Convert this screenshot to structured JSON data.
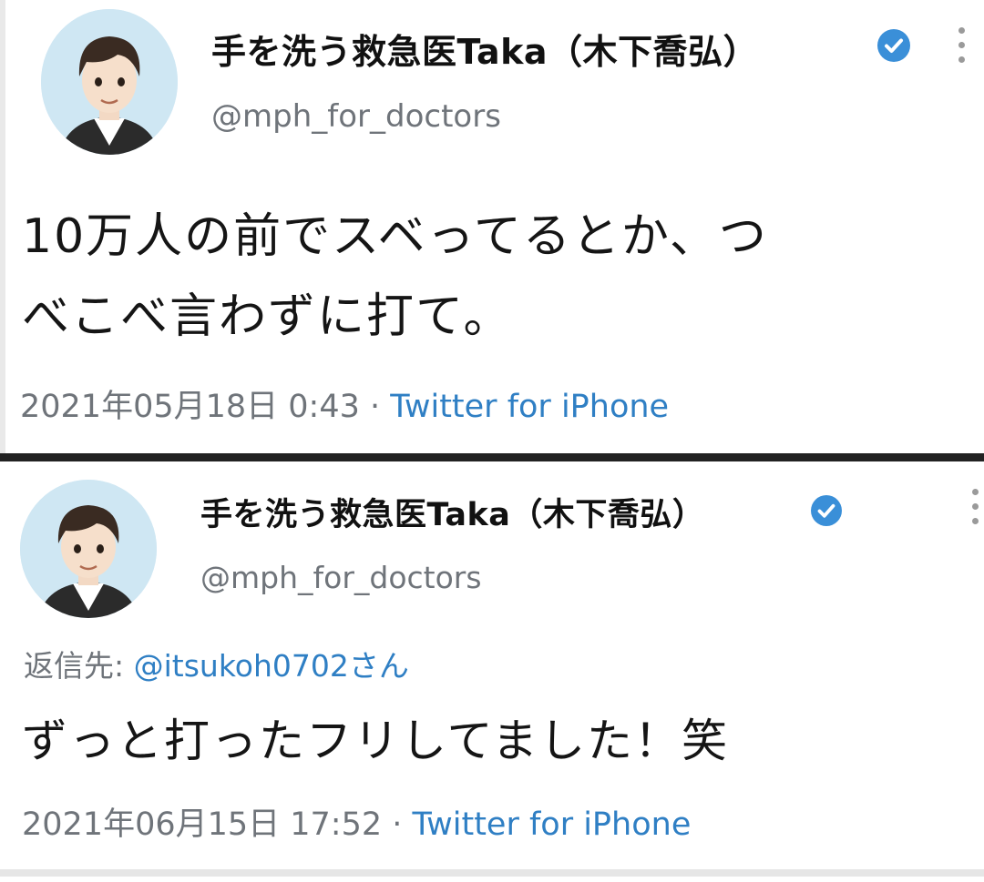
{
  "colors": {
    "link": "#2f7fc4",
    "verified_badge": "#3a8fd8",
    "secondary_text": "#6f747a",
    "divider": "#222222"
  },
  "tweets": [
    {
      "avatar_icon": "cartoon-portrait-avatar",
      "display_name": "手を洗う救急医Taka（木下喬弘）",
      "handle": "@mph_for_doctors",
      "verified_icon": "verified-check-icon",
      "more_icon": "vertical-dots-icon",
      "text_lines": [
        "10万人の前でスベってるとか、つ",
        "べこべ言わずに打て。"
      ],
      "timestamp": "2021年05月18日 0:43",
      "separator": " · ",
      "source": "Twitter for iPhone"
    },
    {
      "avatar_icon": "cartoon-portrait-avatar",
      "display_name": "手を洗う救急医Taka（木下喬弘）",
      "handle": "@mph_for_doctors",
      "verified_icon": "verified-check-icon",
      "more_icon": "vertical-dots-icon",
      "reply_label": "返信先: ",
      "reply_target": "@itsukoh0702",
      "reply_suffix": "さん",
      "text": "ずっと打ったフリしてました！笑",
      "timestamp": "2021年06月15日 17:52",
      "separator": " · ",
      "source": "Twitter for iPhone"
    }
  ]
}
